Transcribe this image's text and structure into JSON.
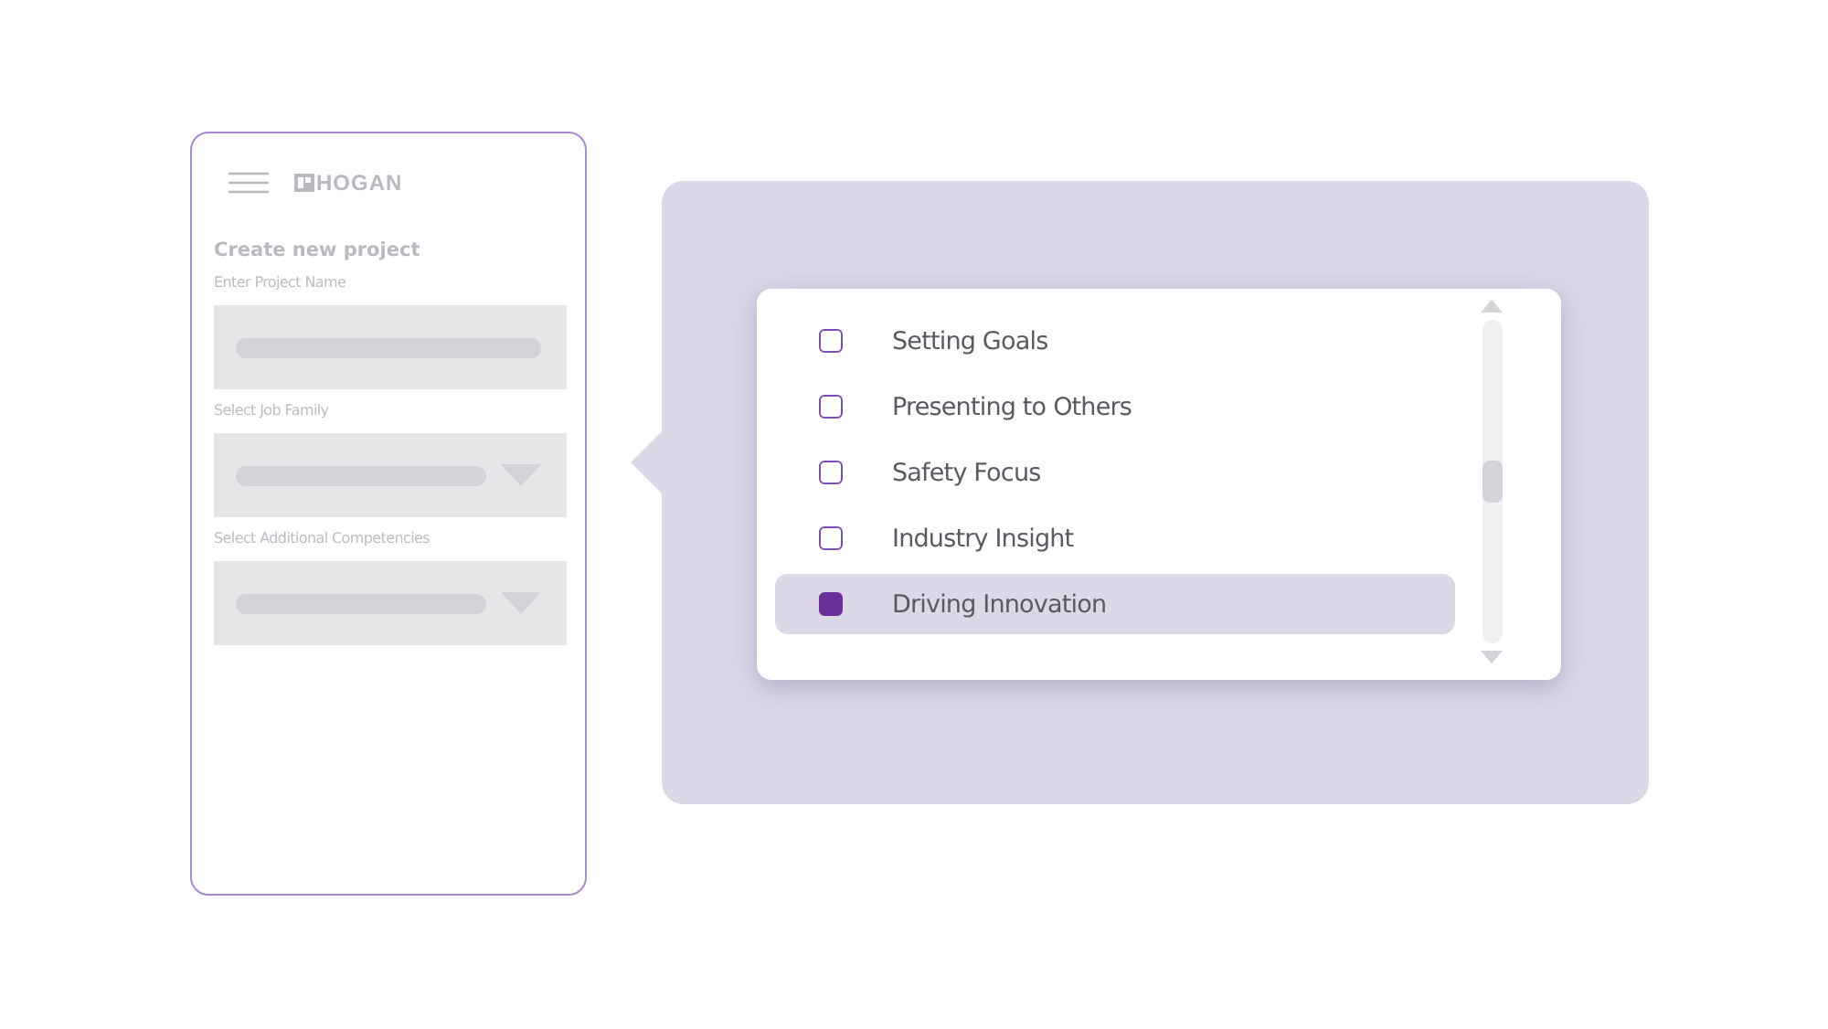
{
  "phone": {
    "logo": "HOGAN",
    "title": "Create new project",
    "fields": [
      {
        "label": "Enter Project Name",
        "kind": "text"
      },
      {
        "label": "Select Job Family",
        "kind": "select"
      },
      {
        "label": "Select Additional Competencies",
        "kind": "select"
      }
    ]
  },
  "options": [
    {
      "label": "Setting Goals",
      "checked": false
    },
    {
      "label": "Presenting to Others",
      "checked": false
    },
    {
      "label": "Safety Focus",
      "checked": false
    },
    {
      "label": "Industry Insight",
      "checked": false
    },
    {
      "label": "Driving Innovation",
      "checked": true
    }
  ]
}
